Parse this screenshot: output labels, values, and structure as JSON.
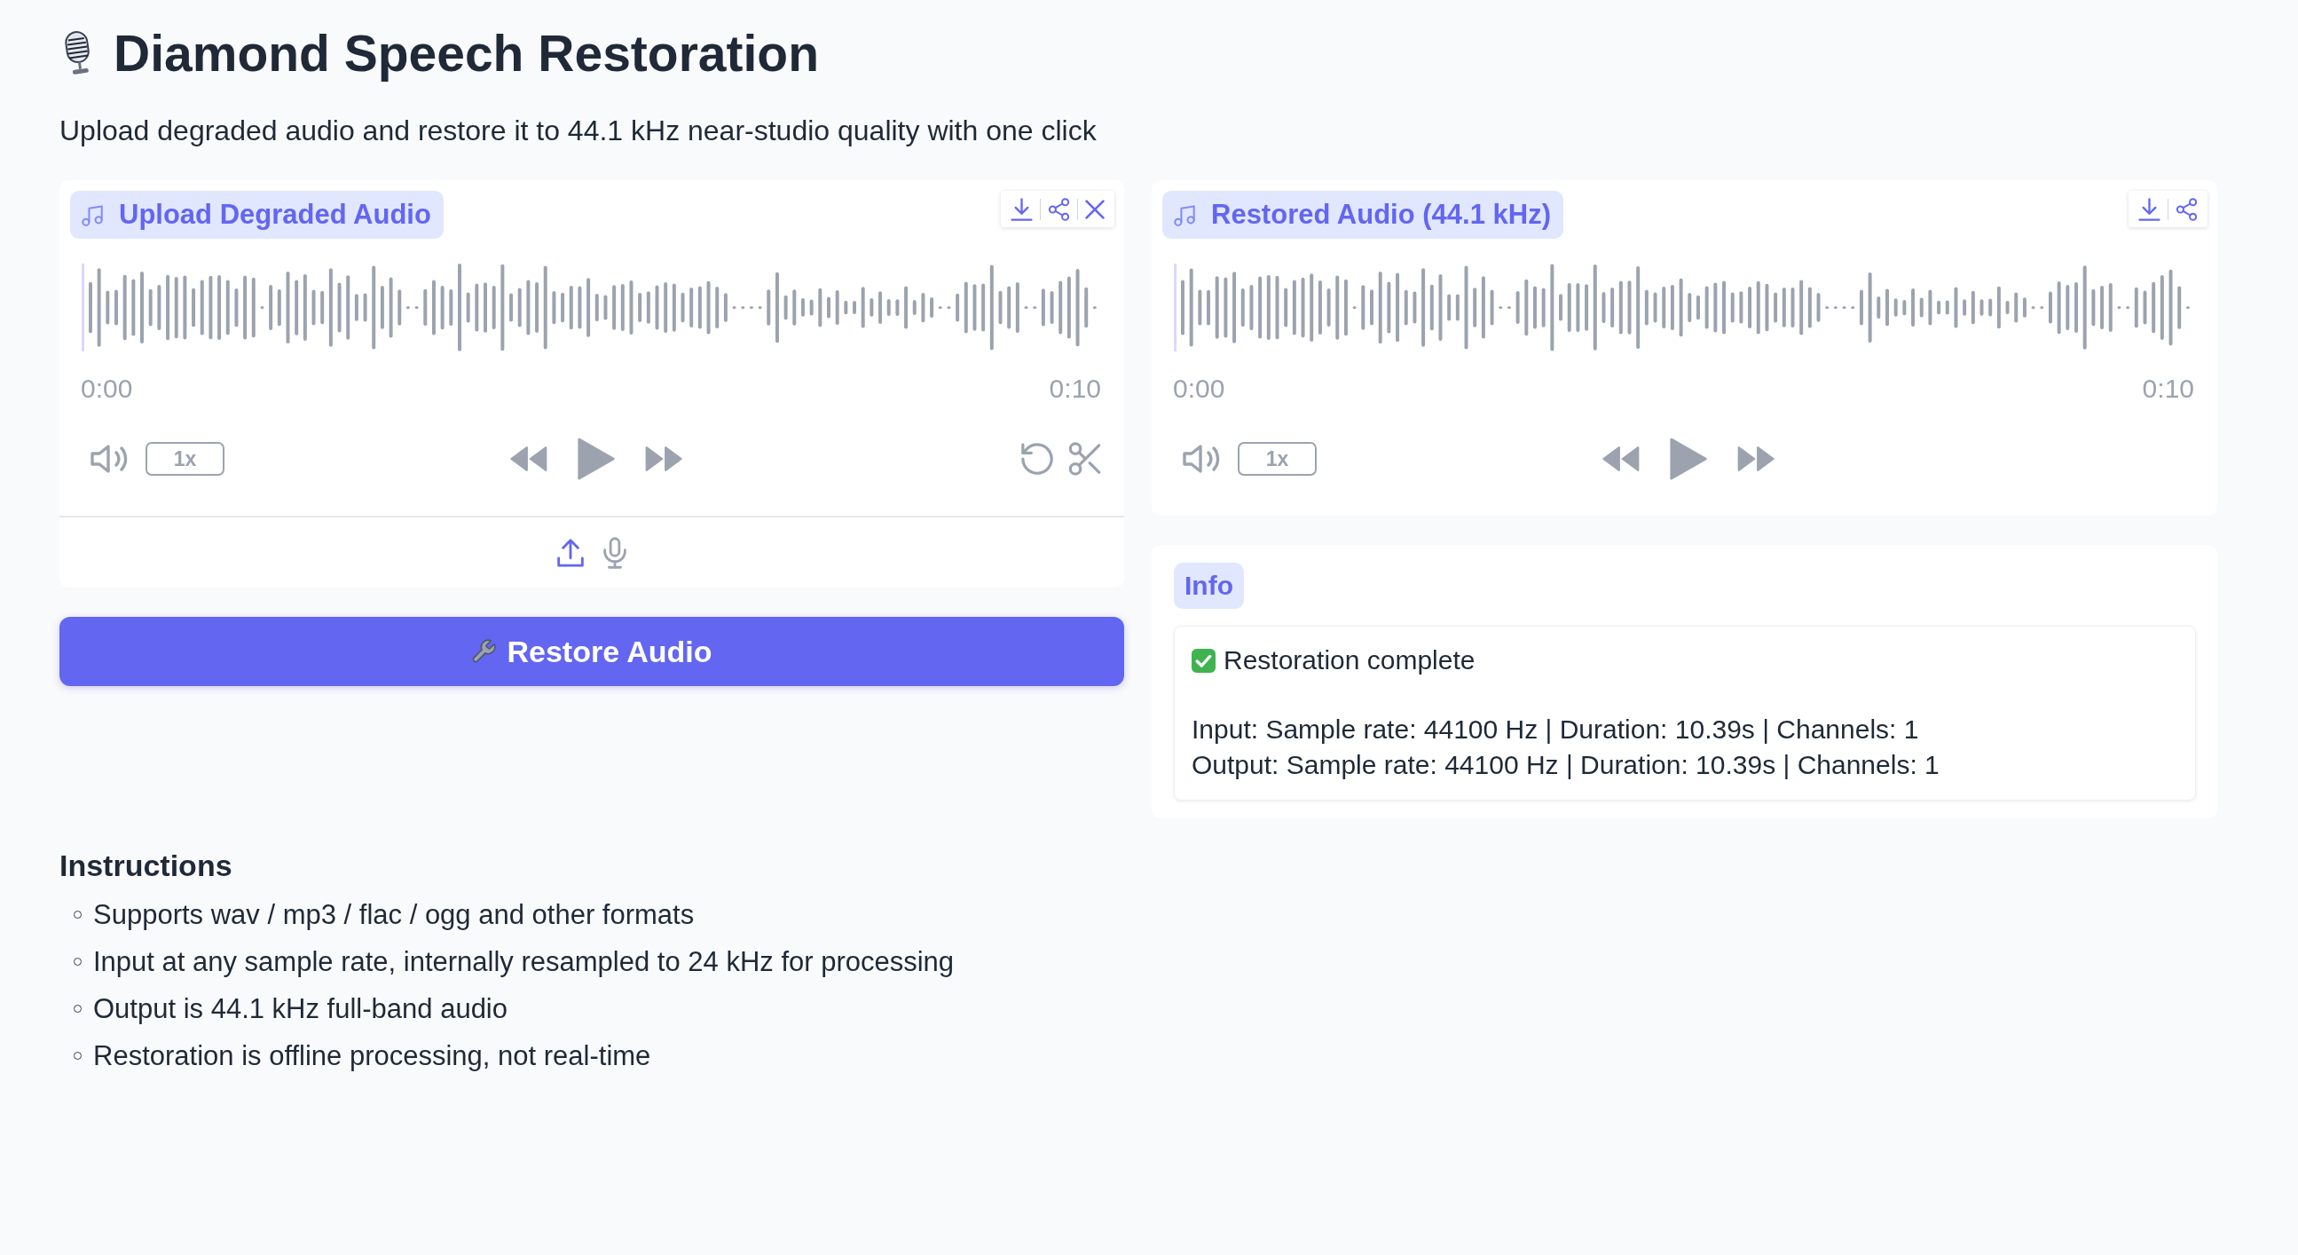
{
  "header": {
    "title": "Diamond Speech Restoration",
    "subtitle": "Upload degraded audio and restore it to 44.1 kHz near-studio quality with one click"
  },
  "input_audio": {
    "label": "Upload Degraded Audio",
    "actions": [
      {
        "kind": "download"
      },
      {
        "kind": "share"
      },
      {
        "kind": "close"
      }
    ],
    "time_start": "0:00",
    "time_end": "0:10",
    "speed": "1x",
    "edit_tools": [
      {
        "kind": "undo"
      },
      {
        "kind": "trim"
      }
    ],
    "sources": [
      {
        "kind": "upload",
        "selected": true
      },
      {
        "kind": "microphone",
        "selected": false
      }
    ]
  },
  "restore_button": {
    "label": "Restore Audio"
  },
  "output_audio": {
    "label": "Restored Audio (44.1 kHz)",
    "actions": [
      {
        "kind": "download"
      },
      {
        "kind": "share"
      }
    ],
    "time_start": "0:00",
    "time_end": "0:10",
    "speed": "1x"
  },
  "info": {
    "label": "Info",
    "status": "Restoration complete",
    "lines": [
      "Input: Sample rate: 44100 Hz | Duration: 10.39s | Channels: 1",
      "Output: Sample rate: 44100 Hz | Duration: 10.39s | Channels: 1"
    ]
  },
  "instructions": {
    "title": "Instructions",
    "items": [
      "Supports wav / mp3 / flac / ogg and other formats",
      "Input at any sample rate, internally resampled to 24 kHz for processing",
      "Output is 44.1 kHz full-band audio",
      "Restoration is offline processing, not real-time"
    ]
  }
}
